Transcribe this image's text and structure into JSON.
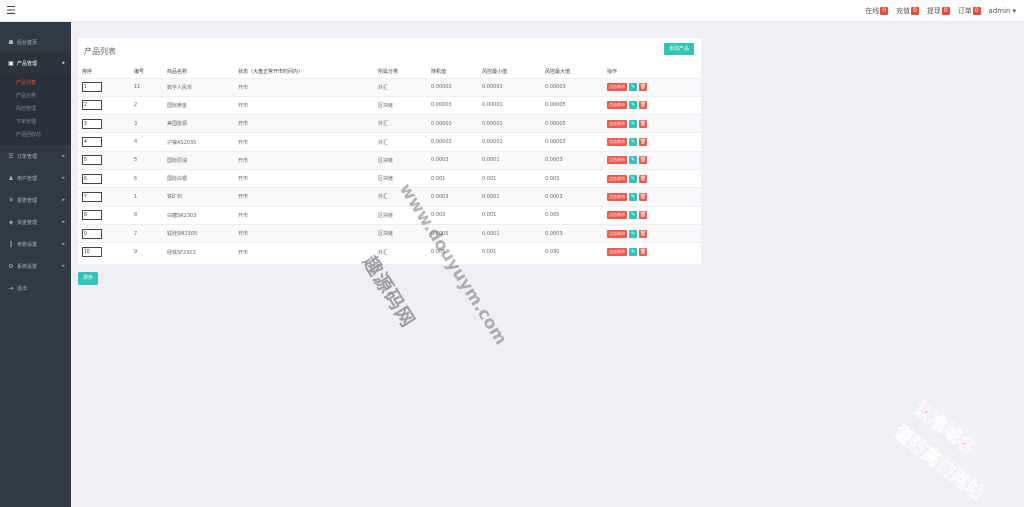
{
  "topbar": {
    "menu_icon": "hamburger-icon",
    "items": [
      {
        "label": "在线",
        "count": "0"
      },
      {
        "label": "充值",
        "count": "0"
      },
      {
        "label": "提现",
        "count": "0"
      },
      {
        "label": "订单",
        "count": "0"
      }
    ],
    "user": "admin",
    "user_caret": "▾"
  },
  "sidebar": {
    "items": [
      {
        "label": "后台首页",
        "icon": "dashboard-icon",
        "glyph": "☗"
      },
      {
        "label": "产品管理",
        "icon": "product-icon",
        "glyph": "▣",
        "arrow": "▸"
      },
      {
        "label": "订单管理",
        "icon": "order-icon",
        "glyph": "☰",
        "arrow": "▸"
      },
      {
        "label": "用户管理",
        "icon": "user-icon",
        "glyph": "♟",
        "arrow": "▸"
      },
      {
        "label": "报表管理",
        "icon": "yen-icon",
        "glyph": "¥",
        "arrow": "▸"
      },
      {
        "label": "资金管理",
        "icon": "fund-icon",
        "glyph": "◈",
        "arrow": "▸"
      },
      {
        "label": "参数设置",
        "icon": "params-icon",
        "glyph": "‖",
        "arrow": "▸"
      },
      {
        "label": "系统设置",
        "icon": "settings-icon",
        "glyph": "⚙",
        "arrow": "▸"
      },
      {
        "label": "退出",
        "icon": "logout-icon",
        "glyph": "⇥"
      }
    ],
    "submenu": [
      "产品列表",
      "产品分类",
      "风控管理",
      "下单管理",
      "产品回收站"
    ]
  },
  "panel": {
    "title": "产品列表",
    "add_button": "添加产品",
    "columns": [
      "排序",
      "编号",
      "商品名称",
      "状态（大盘正常开市时间内）",
      "所属分类",
      "随机值",
      "风控最小值",
      "风控最大值",
      "操作"
    ],
    "op_label": "点击休市",
    "edit_glyph": "✎",
    "delete_glyph": "🗑",
    "rows": [
      {
        "sort": "1",
        "id": "11",
        "name": "数字人民币",
        "status": "开市",
        "category": "外汇",
        "random": "0.00003",
        "min": "0.00001",
        "max": "0.00003"
      },
      {
        "sort": "2",
        "id": "2",
        "name": "国际黄金",
        "status": "开市",
        "category": "区块链",
        "random": "0.00003",
        "min": "0.00001",
        "max": "0.00005"
      },
      {
        "sort": "3",
        "id": "3",
        "name": "美国能源",
        "status": "开市",
        "category": "外汇",
        "random": "0.00003",
        "min": "0.00001",
        "max": "0.00005"
      },
      {
        "sort": "4",
        "id": "4",
        "name": "沪镍AS2035",
        "status": "开市",
        "category": "外汇",
        "random": "0.00003",
        "min": "0.00001",
        "max": "0.00003"
      },
      {
        "sort": "5",
        "id": "5",
        "name": "国际原油",
        "status": "开市",
        "category": "区块链",
        "random": "0.0003",
        "min": "0.0001",
        "max": "0.0003"
      },
      {
        "sort": "6",
        "id": "6",
        "name": "国际白银",
        "status": "开市",
        "category": "区块链",
        "random": "0.001",
        "min": "0.001",
        "max": "0.003"
      },
      {
        "sort": "7",
        "id": "1",
        "name": "铁矿石",
        "status": "开市",
        "category": "外汇",
        "random": "0.0003",
        "min": "0.0001",
        "max": "0.0003"
      },
      {
        "sort": "8",
        "id": "8",
        "name": "白糖SR2303",
        "status": "开市",
        "category": "区块链",
        "random": "0.003",
        "min": "0.001",
        "max": "0.005"
      },
      {
        "sort": "9",
        "id": "7",
        "name": "锰硅SM2305",
        "status": "开市",
        "category": "区块链",
        "random": "0.0005",
        "min": "0.0001",
        "max": "0.0003"
      },
      {
        "sort": "10",
        "id": "9",
        "name": "硅铁SF2303",
        "status": "开市",
        "category": "外汇",
        "random": "0.005",
        "min": "0.001",
        "max": "0.030"
      }
    ]
  },
  "sort_button": "排序",
  "watermarks": {
    "main": "趣源码网",
    "url": "www.douyuym.com",
    "pink1": "认准域名",
    "pink2": "谨防高仿网站"
  }
}
